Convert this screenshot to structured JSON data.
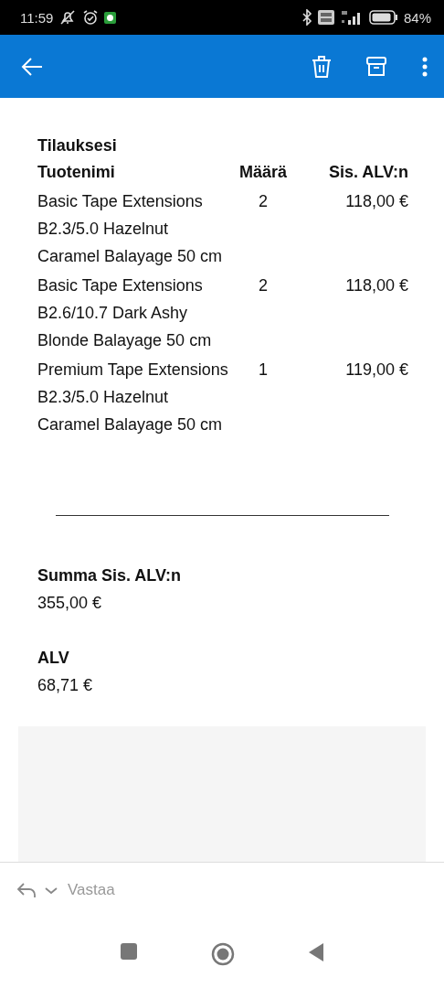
{
  "status_bar": {
    "time": "11:59",
    "battery": "84%"
  },
  "order": {
    "heading": "Tilauksesi",
    "columns": [
      "Tuotenimi",
      "Määrä",
      "Sis. ALV:n"
    ],
    "rows": [
      {
        "name": "Basic Tape Extensions B2.3/5.0 Hazelnut Caramel Balayage 50 cm",
        "quantity": "2",
        "price": "118,00 €"
      },
      {
        "name": "Basic Tape Extensions B2.6/10.7 Dark Ashy Blonde Balayage 50 cm",
        "quantity": "2",
        "price": "118,00 €"
      },
      {
        "name": "Premium Tape Extensions B2.3/5.0 Hazelnut Caramel Balayage 50 cm",
        "quantity": "1",
        "price": "119,00 €"
      }
    ]
  },
  "totals": [
    {
      "label": "Summa Sis. ALV:n",
      "value": "355,00 €"
    },
    {
      "label": "ALV",
      "value": "68,71 €"
    }
  ],
  "reply": {
    "label": "Vastaa"
  }
}
